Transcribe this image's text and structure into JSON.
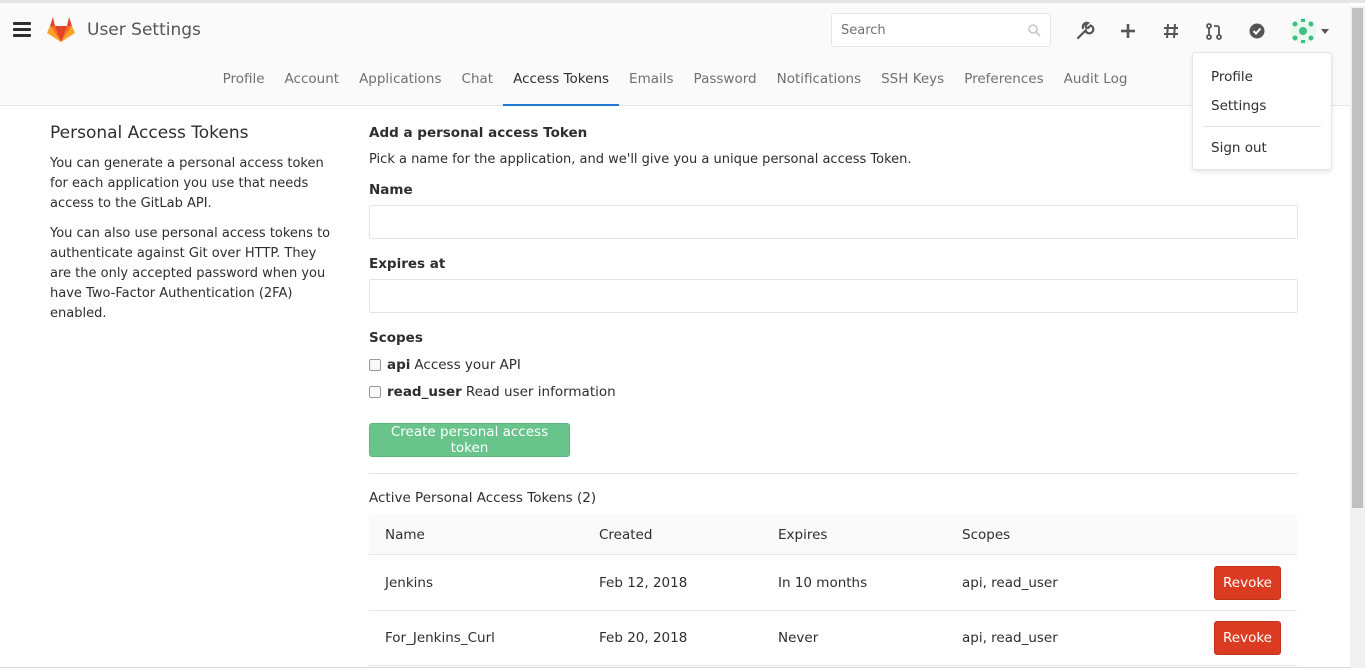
{
  "header": {
    "title": "User Settings",
    "search_placeholder": "Search",
    "icons": [
      "menu-icon",
      "gitlab-logo",
      "wrench-icon",
      "plus-icon",
      "hash-icon",
      "merge-request-icon",
      "todo-check-icon",
      "user-avatar"
    ],
    "brand_color": "#e24329"
  },
  "tabs": [
    {
      "label": "Profile",
      "active": false
    },
    {
      "label": "Account",
      "active": false
    },
    {
      "label": "Applications",
      "active": false
    },
    {
      "label": "Chat",
      "active": false
    },
    {
      "label": "Access Tokens",
      "active": true
    },
    {
      "label": "Emails",
      "active": false
    },
    {
      "label": "Password",
      "active": false
    },
    {
      "label": "Notifications",
      "active": false
    },
    {
      "label": "SSH Keys",
      "active": false
    },
    {
      "label": "Preferences",
      "active": false
    },
    {
      "label": "Audit Log",
      "active": false
    }
  ],
  "sidebar": {
    "title": "Personal Access Tokens",
    "paragraph1": "You can generate a personal access token for each application you use that needs access to the GitLab API.",
    "paragraph2": "You can also use personal access tokens to authenticate against Git over HTTP. They are the only accepted password when you have Two-Factor Authentication (2FA) enabled."
  },
  "form": {
    "heading": "Add a personal access Token",
    "description": "Pick a name for the application, and we'll give you a unique personal access Token.",
    "name_label": "Name",
    "name_value": "",
    "expires_label": "Expires at",
    "expires_value": "",
    "scopes_label": "Scopes",
    "scopes": [
      {
        "name": "api",
        "description": "Access your API",
        "checked": false
      },
      {
        "name": "read_user",
        "description": "Read user information",
        "checked": false
      }
    ],
    "submit_label": "Create personal access token",
    "submit_color": "#69c48c"
  },
  "active_tokens": {
    "heading": "Active Personal Access Tokens (2)",
    "columns": [
      "Name",
      "Created",
      "Expires",
      "Scopes"
    ],
    "rows": [
      {
        "name": "Jenkins",
        "created": "Feb 12, 2018",
        "expires": "In 10 months",
        "scopes": "api, read_user",
        "action": "Revoke"
      },
      {
        "name": "For_Jenkins_Curl",
        "created": "Feb 20, 2018",
        "expires": "Never",
        "scopes": "api, read_user",
        "action": "Revoke"
      }
    ],
    "revoke_color": "#db3b21"
  },
  "user_menu": {
    "items": [
      "Profile",
      "Settings"
    ],
    "sign_out": "Sign out"
  }
}
